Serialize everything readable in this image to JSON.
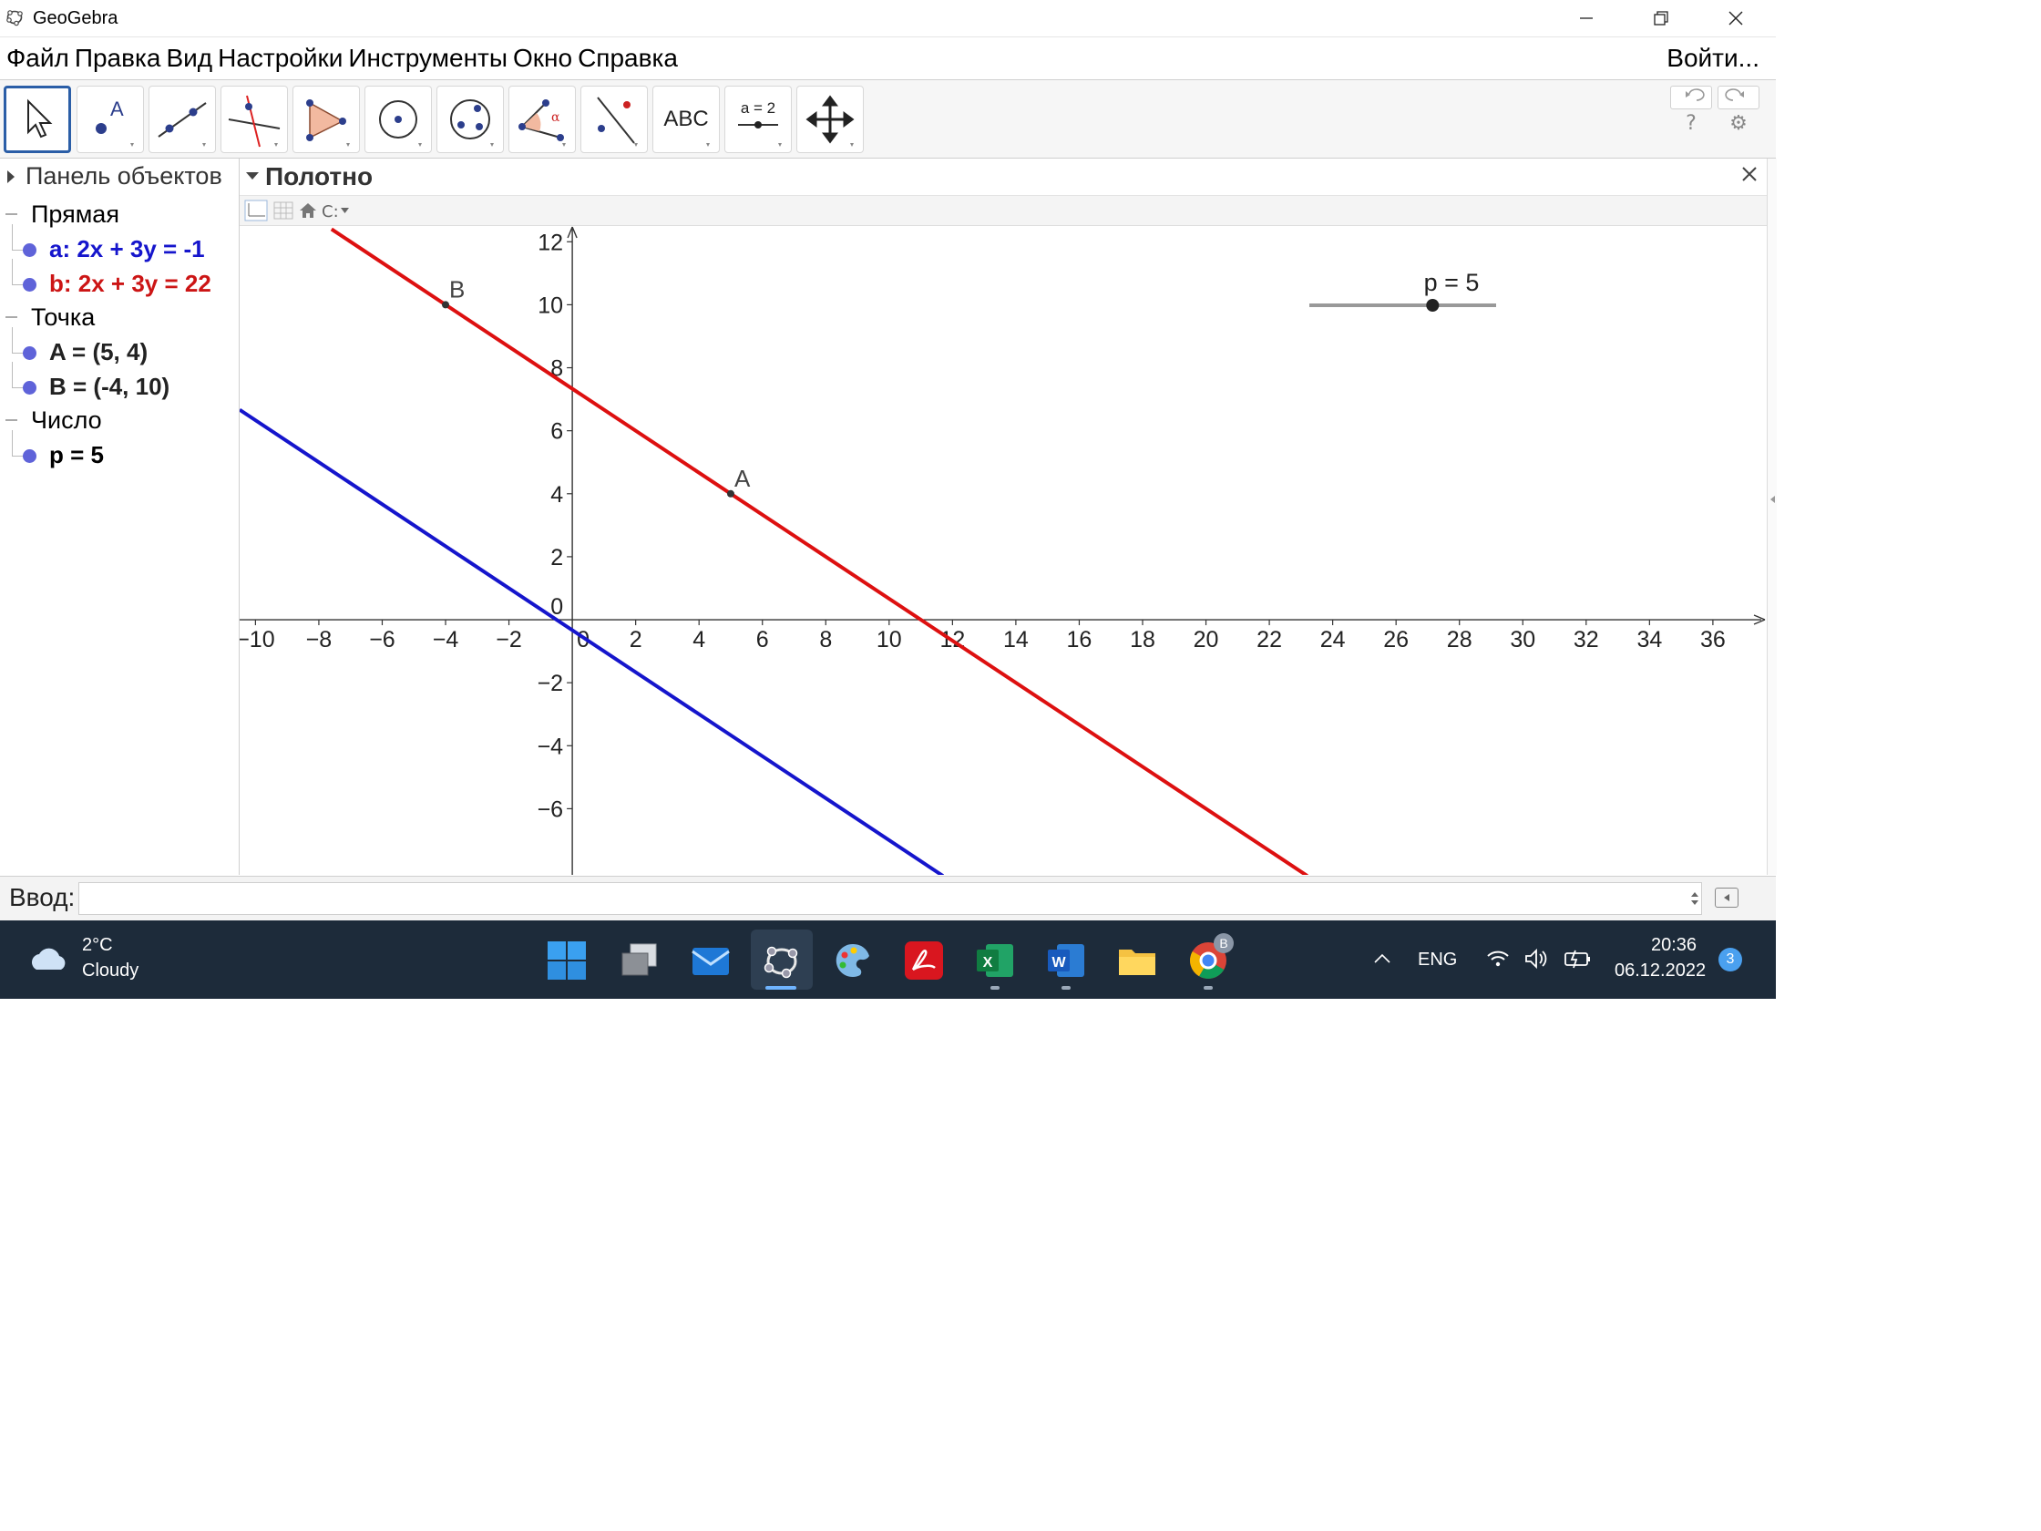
{
  "window": {
    "title": "GeoGebra"
  },
  "menu": {
    "items": [
      "Файл",
      "Правка",
      "Вид",
      "Настройки",
      "Инструменты",
      "Окно",
      "Справка"
    ],
    "login": "Войти..."
  },
  "toolbar": {
    "tools": [
      {
        "name": "move-tool-icon"
      },
      {
        "name": "point-tool-icon"
      },
      {
        "name": "line-tool-icon"
      },
      {
        "name": "perpendicular-line-tool-icon"
      },
      {
        "name": "polygon-tool-icon"
      },
      {
        "name": "circle-tool-icon"
      },
      {
        "name": "circle-three-points-tool-icon"
      },
      {
        "name": "angle-tool-icon"
      },
      {
        "name": "reflect-tool-icon"
      },
      {
        "name": "text-tool-icon",
        "label": "ABC"
      },
      {
        "name": "slider-tool-icon",
        "label": "a = 2"
      },
      {
        "name": "move-graphics-tool-icon"
      }
    ],
    "help": "?",
    "settings": "⚙"
  },
  "algebra": {
    "title": "Панель объектов",
    "groups": [
      {
        "label": "Прямая",
        "objects": [
          {
            "text": "a: 2x + 3y = -1",
            "color": "#1515cc"
          },
          {
            "text": "b: 2x + 3y = 22",
            "color": "#cc1515"
          }
        ]
      },
      {
        "label": "Точка",
        "objects": [
          {
            "text": "A = (5, 4)",
            "color": "#222222"
          },
          {
            "text": "B = (-4, 10)",
            "color": "#222222"
          }
        ]
      },
      {
        "label": "Число",
        "objects": [
          {
            "text": "p = 5",
            "color": "#000000"
          }
        ]
      }
    ]
  },
  "graphics": {
    "title": "Полотно",
    "x_ticks": [
      "-10",
      "-8",
      "-6",
      "-4",
      "-2",
      "0",
      "2",
      "4",
      "6",
      "8",
      "10",
      "12",
      "14",
      "16",
      "18",
      "20",
      "22",
      "24",
      "26",
      "28",
      "30",
      "32",
      "34",
      "36"
    ],
    "y_ticks": [
      "12",
      "10",
      "8",
      "6",
      "4",
      "2",
      "-2",
      "-4",
      "-6"
    ],
    "origin_label": "0",
    "point_labels": {
      "A": "A",
      "B": "B"
    },
    "slider_label": "p = 5",
    "line_colors": {
      "a": "#1515cc",
      "b": "#dd1010"
    }
  },
  "chart_data": {
    "type": "line",
    "title": "",
    "xlim": [
      -10.5,
      37.7
    ],
    "ylim": [
      -8.1,
      12.5
    ],
    "series": [
      {
        "name": "a",
        "equation": "2x + 3y = -1",
        "points": [
          [
            -10.5,
            6.667
          ],
          [
            11.7,
            -8.133
          ]
        ]
      },
      {
        "name": "b",
        "equation": "2x + 3y = 22",
        "points": [
          [
            -7.6,
            12.4
          ],
          [
            23.2,
            -8.133
          ]
        ]
      }
    ],
    "points": [
      {
        "name": "A",
        "x": 5,
        "y": 4
      },
      {
        "name": "B",
        "x": -4,
        "y": 10
      }
    ],
    "slider": {
      "name": "p",
      "value": 5
    }
  },
  "input_bar": {
    "label": "Ввод:",
    "value": ""
  },
  "taskbar": {
    "weather_temp": "2°C",
    "weather_desc": "Cloudy",
    "lang": "ENG",
    "time": "20:36",
    "date": "06.12.2022",
    "notifications": "3",
    "chrome_badge": "B"
  }
}
